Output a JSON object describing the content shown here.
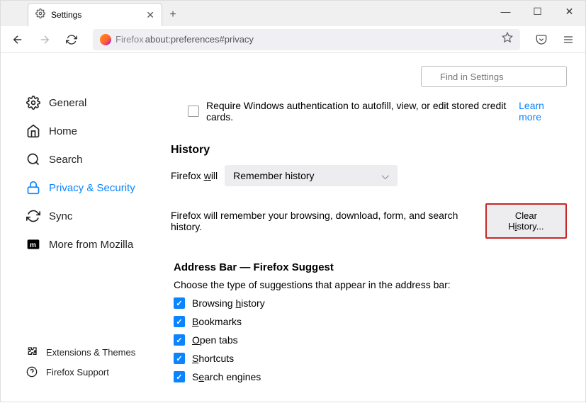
{
  "tab": {
    "title": "Settings"
  },
  "urlbar": {
    "prefix": "Firefox",
    "path": "about:preferences#privacy"
  },
  "search": {
    "placeholder": "Find in Settings"
  },
  "sidebar": {
    "general": "General",
    "home": "Home",
    "search": "Search",
    "privacy": "Privacy & Security",
    "sync": "Sync",
    "more": "More from Mozilla",
    "ext": "Extensions & Themes",
    "support": "Firefox Support"
  },
  "credit": {
    "label": "Require Windows authentication to autofill, view, or edit stored credit cards.",
    "learn": "Learn more"
  },
  "history": {
    "heading": "History",
    "label_pre": "Firefox ",
    "label_under": "w",
    "label_post": "ill",
    "select": "Remember history",
    "desc": "Firefox will remember your browsing, download, form, and search history.",
    "clear_pre": "Clear H",
    "clear_under": "i",
    "clear_post": "story..."
  },
  "addrbar": {
    "heading": "Address Bar — Firefox Suggest",
    "sub": "Choose the type of suggestions that appear in the address bar:",
    "browsing_pre": "Browsing ",
    "browsing_under": "h",
    "browsing_post": "istory",
    "bookmarks_under": "B",
    "bookmarks_post": "ookmarks",
    "opentabs_under": "O",
    "opentabs_post": "pen tabs",
    "shortcuts_under": "S",
    "shortcuts_post": "hortcuts",
    "searcheng_pre": "S",
    "searcheng_under": "e",
    "searcheng_post": "arch engines"
  }
}
